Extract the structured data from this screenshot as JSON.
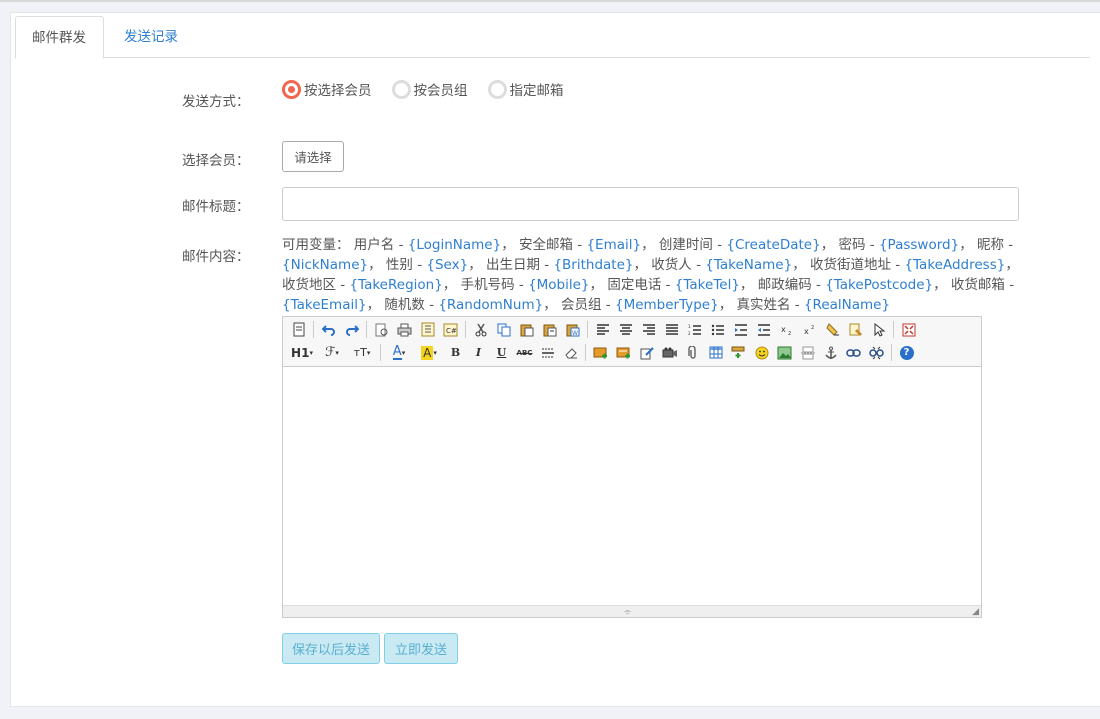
{
  "tabs": [
    {
      "label": "邮件群发",
      "active": true
    },
    {
      "label": "发送记录",
      "active": false
    }
  ],
  "send_method": {
    "label": "发送方式：",
    "options": [
      {
        "label": "按选择会员",
        "checked": true
      },
      {
        "label": "按会员组",
        "checked": false
      },
      {
        "label": "指定邮箱",
        "checked": false
      }
    ]
  },
  "member": {
    "label": "选择会员：",
    "button": "请选择"
  },
  "subject": {
    "label": "邮件标题：",
    "value": ""
  },
  "content": {
    "label": "邮件内容：",
    "vars_intro": "可用变量：",
    "vars": [
      {
        "name": "用户名",
        "code": "{LoginName}"
      },
      {
        "name": "安全邮箱",
        "code": "{Email}"
      },
      {
        "name": "创建时间",
        "code": "{CreateDate}"
      },
      {
        "name": "密码",
        "code": "{Password}"
      },
      {
        "name": "昵称",
        "code": "{NickName}"
      },
      {
        "name": "性别",
        "code": "{Sex}"
      },
      {
        "name": "出生日期",
        "code": "{Brithdate}"
      },
      {
        "name": "收货人",
        "code": "{TakeName}"
      },
      {
        "name": "收货街道地址",
        "code": "{TakeAddress}"
      },
      {
        "name": "收货地区",
        "code": "{TakeRegion}"
      },
      {
        "name": "手机号码",
        "code": "{Mobile}"
      },
      {
        "name": "固定电话",
        "code": "{TakeTel}"
      },
      {
        "name": "邮政编码",
        "code": "{TakePostcode}"
      },
      {
        "name": "收货邮箱",
        "code": "{TakeEmail}"
      },
      {
        "name": "随机数",
        "code": "{RandomNum}"
      },
      {
        "name": "会员组",
        "code": "{MemberType}"
      },
      {
        "name": "真实姓名",
        "code": "{RealName}"
      }
    ],
    "editor_text": ""
  },
  "toolbar": {
    "h1": "H1",
    "font": "ℱ",
    "fontsize": "тT",
    "forecolor": "A",
    "backcolor": "A",
    "bold": "B",
    "italic": "I",
    "underline": "U",
    "strike": "ABC",
    "help": "?"
  },
  "actions": {
    "save_later": "保存以后发送",
    "send_now": "立即发送"
  },
  "colors": {
    "link": "#2e7fd1",
    "radio_on": "#f0664f",
    "action_bg": "#c9eaf3"
  }
}
